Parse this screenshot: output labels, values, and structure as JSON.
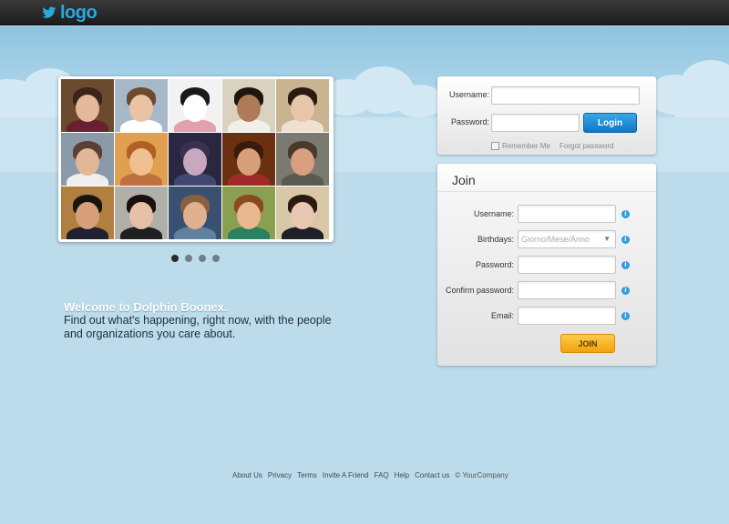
{
  "header": {
    "logo_text": "logo",
    "logo_icon": "bird-icon"
  },
  "slider": {
    "photos": [
      {
        "bg": "#6b4a2e",
        "hair": "#3b2418",
        "skin": "#e4b89a",
        "cloth": "#6a2030"
      },
      {
        "bg": "#a7b9c8",
        "hair": "#6b4a30",
        "skin": "#eac3a4",
        "cloth": "#ffffff"
      },
      {
        "bg": "#f2f2f2",
        "hair": "#1a1a1a",
        "skin": "#ffffff",
        "cloth": "#e0a0b0"
      },
      {
        "bg": "#d9d2c0",
        "hair": "#1e1410",
        "skin": "#b07a58",
        "cloth": "#f4f0e8"
      },
      {
        "bg": "#c8b490",
        "hair": "#2a1a10",
        "skin": "#e8c6ac",
        "cloth": "#f0e0d0"
      },
      {
        "bg": "#8a9aa8",
        "hair": "#5a4030",
        "skin": "#e0b898",
        "cloth": "#eeeeee"
      },
      {
        "bg": "#e0a050",
        "hair": "#b06020",
        "skin": "#f0c090",
        "cloth": "#c07040"
      },
      {
        "bg": "#2a2840",
        "hair": "#3a3050",
        "skin": "#c8a8c0",
        "cloth": "#404870"
      },
      {
        "bg": "#6a3010",
        "hair": "#3a1a0a",
        "skin": "#d8a078",
        "cloth": "#a02a2a"
      },
      {
        "bg": "#7a7a70",
        "hair": "#4a3a2a",
        "skin": "#d8a080",
        "cloth": "#5a5a50"
      },
      {
        "bg": "#b08040",
        "hair": "#1a1410",
        "skin": "#d8a07a",
        "cloth": "#202030"
      },
      {
        "bg": "#b0b0a8",
        "hair": "#1a1010",
        "skin": "#e8c0a8",
        "cloth": "#202020"
      },
      {
        "bg": "#3a5070",
        "hair": "#8a6040",
        "skin": "#e0b090",
        "cloth": "#6080a0"
      },
      {
        "bg": "#8aa050",
        "hair": "#8a4a20",
        "skin": "#e8b890",
        "cloth": "#2a8060"
      },
      {
        "bg": "#d8c8a8",
        "hair": "#2a1a10",
        "skin": "#e8c8b0",
        "cloth": "#202028"
      }
    ],
    "dots_count": 4,
    "active_dot": 0
  },
  "welcome": {
    "title": "Welcome to Dolphin Boonex.",
    "line1": "Find out what's happening, right now, with the people",
    "line2": "and organizations you care about."
  },
  "login": {
    "username_label": "Username:",
    "password_label": "Password:",
    "login_button": "Login",
    "remember_label": "Remember Me",
    "forgot_label": "Forgot password"
  },
  "join": {
    "title": "Join",
    "username_label": "Username:",
    "birthdays_label": "Birthdays:",
    "birthdays_placeholder": "Giorno/Mese/Anno",
    "password_label": "Password:",
    "confirm_label": "Confirm password:",
    "email_label": "Email:",
    "join_button": "JOIN",
    "info_icon": "info-icon"
  },
  "footer": {
    "links": [
      "About Us",
      "Privacy",
      "Terms",
      "Invite A Friend",
      "FAQ",
      "Help",
      "Contact us"
    ],
    "copyright": "© YourCompany"
  },
  "colors": {
    "accent": "#2aa9e0",
    "login_button": "#1a86d0",
    "join_button": "#f6b21e",
    "sky": "#bcdcec"
  }
}
